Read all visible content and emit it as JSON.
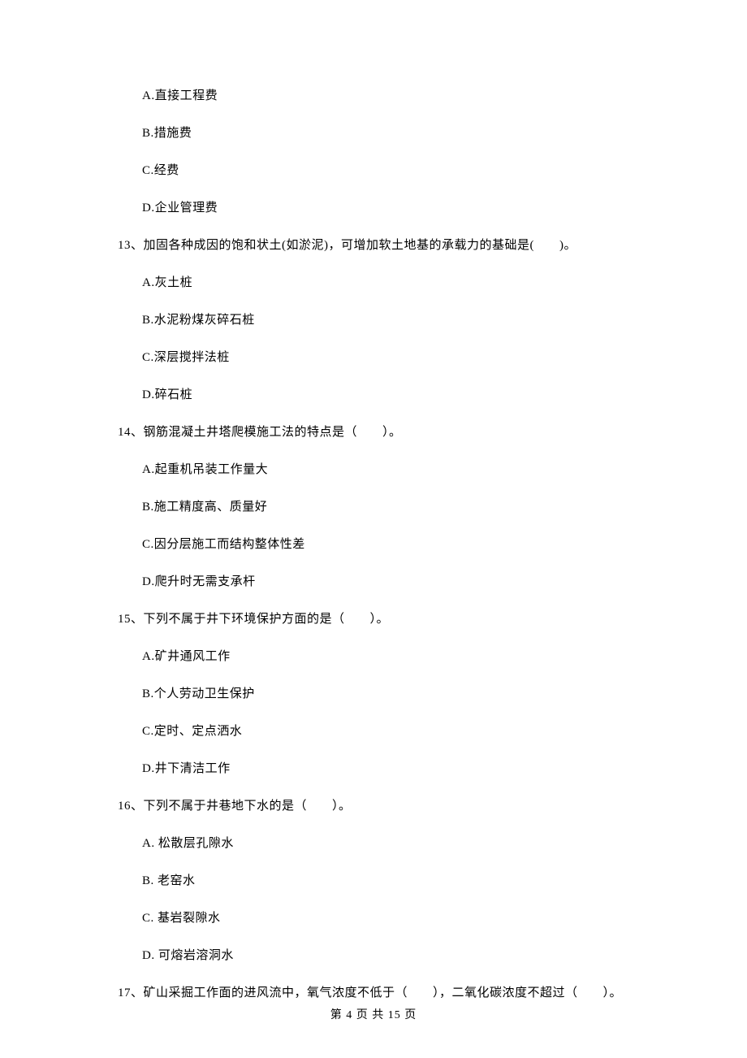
{
  "q12_options": {
    "A": "A.直接工程费",
    "B": "B.措施费",
    "C": "C.经费",
    "D": "D.企业管理费"
  },
  "q13": {
    "text": "13、加固各种成因的饱和状土(如淤泥)，可增加软土地基的承载力的基础是(　　)。",
    "A": "A.灰土桩",
    "B": "B.水泥粉煤灰碎石桩",
    "C": "C.深层搅拌法桩",
    "D": "D.碎石桩"
  },
  "q14": {
    "text": "14、钢筋混凝土井塔爬模施工法的特点是（　　）。",
    "A": "A.起重机吊装工作量大",
    "B": "B.施工精度高、质量好",
    "C": "C.因分层施工而结构整体性差",
    "D": "D.爬升时无需支承杆"
  },
  "q15": {
    "text": "15、下列不属于井下环境保护方面的是（　　）。",
    "A": "A.矿井通风工作",
    "B": "B.个人劳动卫生保护",
    "C": "C.定时、定点洒水",
    "D": "D.井下清洁工作"
  },
  "q16": {
    "text": "16、下列不属于井巷地下水的是（　　）。",
    "A": "A.  松散层孔隙水",
    "B": "B.  老窑水",
    "C": "C.  基岩裂隙水",
    "D": "D.  可熔岩溶洞水"
  },
  "q17": {
    "text": "17、矿山采掘工作面的进风流中，氧气浓度不低于（　　），二氧化碳浓度不超过（　　）。"
  },
  "footer": "第 4 页 共 15 页"
}
